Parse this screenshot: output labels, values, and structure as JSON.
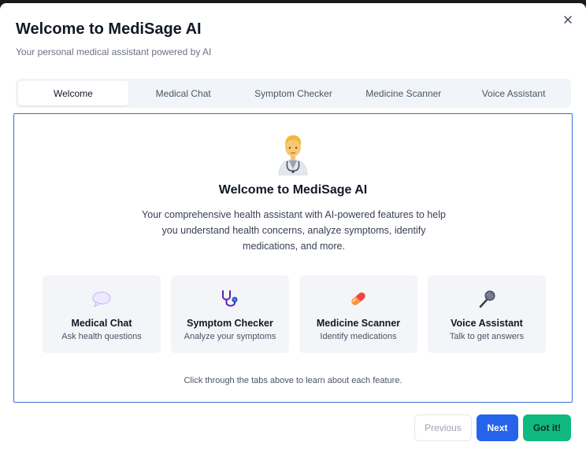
{
  "dialog": {
    "title": "Welcome to MediSage AI",
    "subtitle": "Your personal medical assistant powered by AI",
    "close_icon": "close-icon"
  },
  "tabs": [
    {
      "label": "Welcome",
      "active": true
    },
    {
      "label": "Medical Chat",
      "active": false
    },
    {
      "label": "Symptom Checker",
      "active": false
    },
    {
      "label": "Medicine Scanner",
      "active": false
    },
    {
      "label": "Voice Assistant",
      "active": false
    }
  ],
  "welcome": {
    "hero_icon": "doctor-icon",
    "title": "Welcome to MediSage AI",
    "description": "Your comprehensive health assistant with AI-powered features to help you understand health concerns, analyze symptoms, identify medications, and more.",
    "features": [
      {
        "icon": "speech-bubble-icon",
        "title": "Medical Chat",
        "desc": "Ask health questions"
      },
      {
        "icon": "stethoscope-icon",
        "title": "Symptom Checker",
        "desc": "Analyze your symptoms"
      },
      {
        "icon": "pill-icon",
        "title": "Medicine Scanner",
        "desc": "Identify medications"
      },
      {
        "icon": "microphone-icon",
        "title": "Voice Assistant",
        "desc": "Talk to get answers"
      }
    ],
    "hint": "Click through the tabs above to learn about each feature."
  },
  "footer": {
    "previous_label": "Previous",
    "next_label": "Next",
    "done_label": "Got it!"
  },
  "colors": {
    "accent": "#2563eb",
    "success": "#10b981",
    "focus_border": "#3b6fd8"
  }
}
